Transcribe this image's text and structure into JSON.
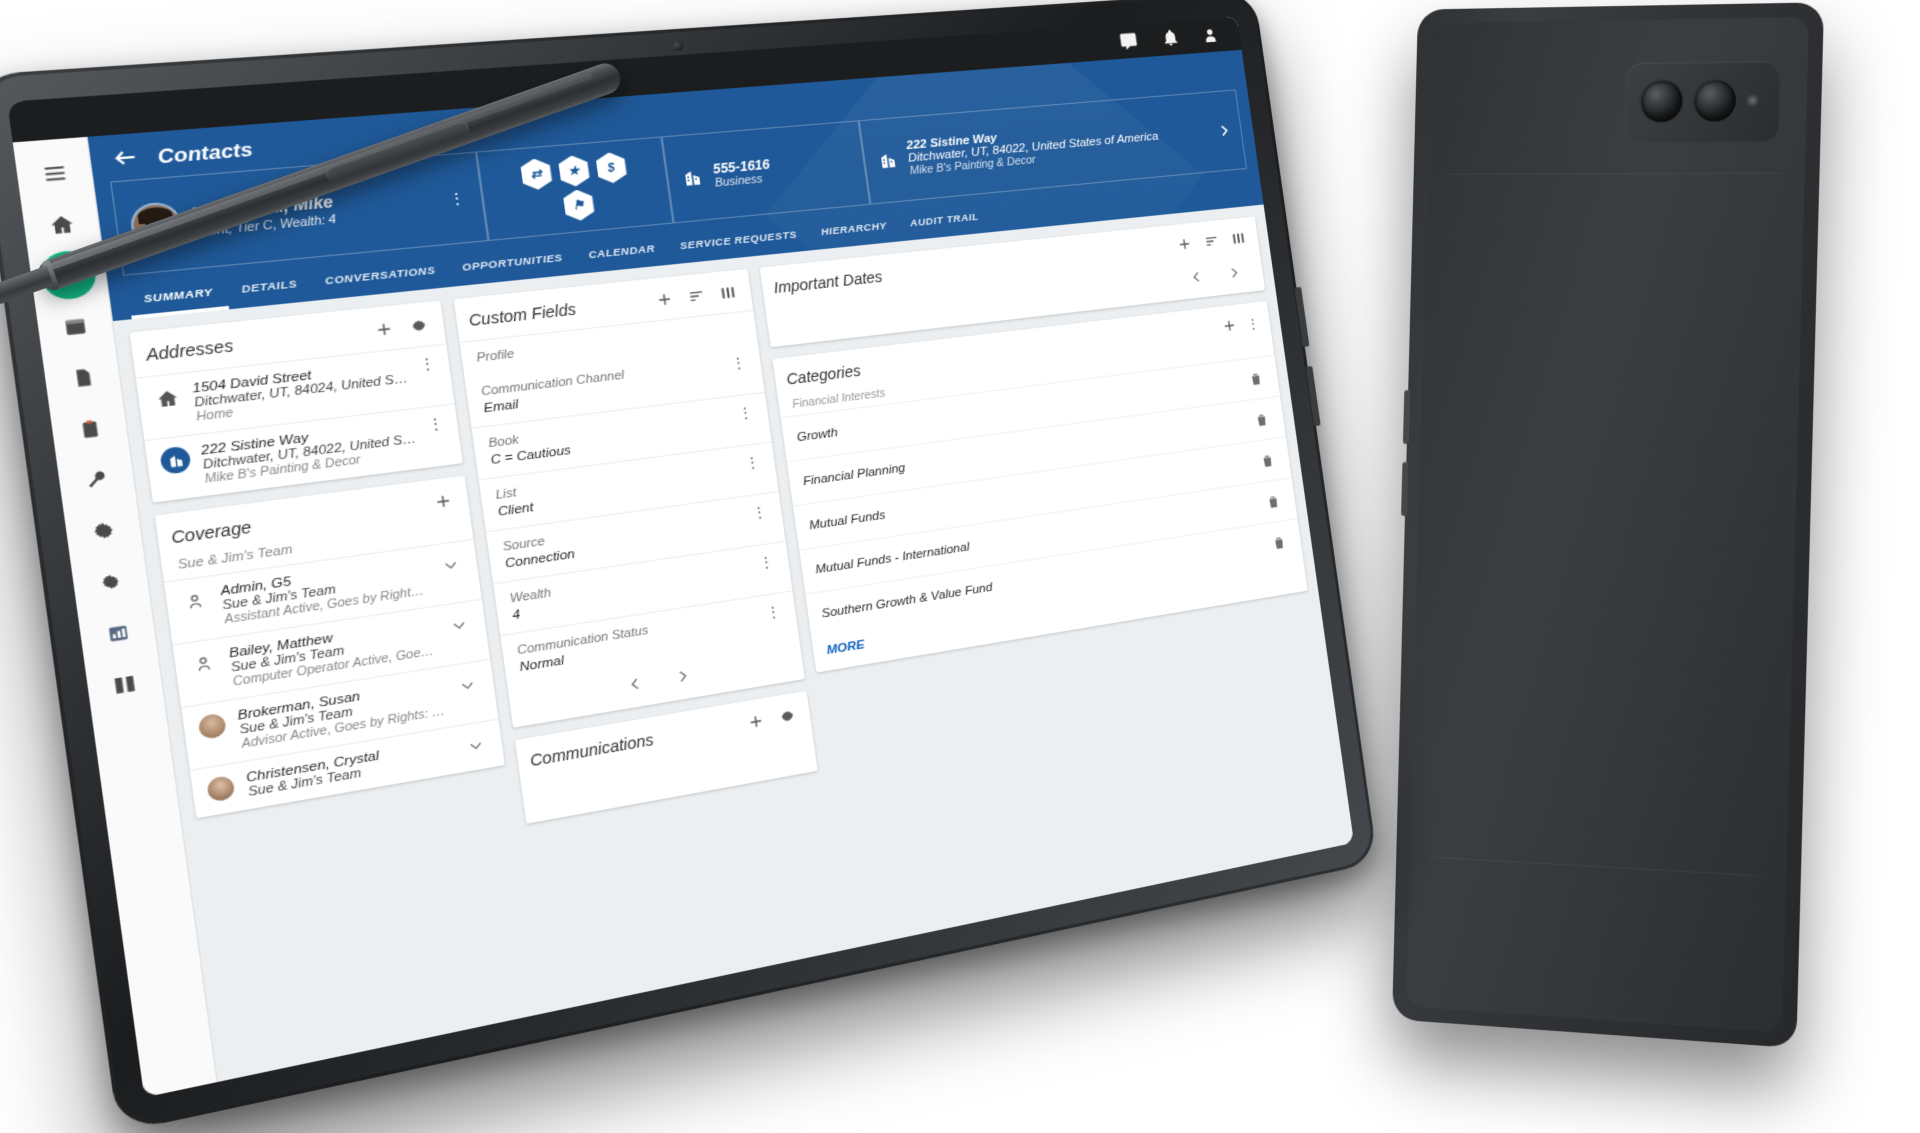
{
  "statusbar": {
    "icons": [
      "message-icon",
      "bell-icon",
      "user-icon"
    ]
  },
  "rail": {
    "items": [
      {
        "name": "menu",
        "icon": "hamburger-menu-icon",
        "active": false
      },
      {
        "name": "home",
        "icon": "home-icon",
        "active": false
      },
      {
        "name": "contacts",
        "icon": "person-circle-icon",
        "active": true
      },
      {
        "name": "calendar",
        "icon": "calendar-icon",
        "active": false
      },
      {
        "name": "notes",
        "icon": "document-icon",
        "active": false
      },
      {
        "name": "tasks",
        "icon": "clipboard-icon",
        "active": false
      },
      {
        "name": "tools",
        "icon": "wrench-icon",
        "active": false
      },
      {
        "name": "settings-gear",
        "icon": "gear-icon",
        "active": false
      },
      {
        "name": "preferences",
        "icon": "gear-small-icon",
        "active": false
      },
      {
        "name": "reports",
        "icon": "chart-icon",
        "active": false
      },
      {
        "name": "library",
        "icon": "book-icon",
        "active": false
      }
    ]
  },
  "topbar": {
    "back_icon": "back-arrow-icon",
    "title": "Contacts",
    "contact": {
      "name": "Buonarroti, Mike",
      "subtitle": "Client, Tier C, Wealth: 4",
      "kebab": "⋮"
    },
    "badges": [
      {
        "glyph": "⇄",
        "name": "exchange-badge"
      },
      {
        "glyph": "★",
        "name": "star-badge"
      },
      {
        "glyph": "$",
        "name": "dollar-badge"
      },
      {
        "glyph": "⚑",
        "name": "flag-badge"
      }
    ],
    "phone": {
      "number": "555-1616",
      "label": "Business",
      "icon": "building-icon"
    },
    "address": {
      "line1": "222 Sistine Way",
      "line2": "Ditchwater, UT, 84022, United States of America",
      "line3": "Mike B's Painting & Decor",
      "icon": "building-icon",
      "next_icon": "chevron-right-icon"
    }
  },
  "tabs": [
    {
      "label": "SUMMARY",
      "active": true
    },
    {
      "label": "DETAILS",
      "active": false
    },
    {
      "label": "CONVERSATIONS",
      "active": false
    },
    {
      "label": "OPPORTUNITIES",
      "active": false
    },
    {
      "label": "CALENDAR",
      "active": false
    },
    {
      "label": "SERVICE REQUESTS",
      "active": false
    },
    {
      "label": "HIERARCHY",
      "active": false
    },
    {
      "label": "AUDIT TRAIL",
      "active": false
    }
  ],
  "cards": {
    "addresses": {
      "title": "Addresses",
      "add_icon": "plus-icon",
      "settings_icon": "gear-icon",
      "rows": [
        {
          "icon": "home-icon",
          "main": "1504 David Street",
          "sub": "Ditchwater, UT, 84024, United States of A…",
          "sub2": "Home",
          "kebab": "⋮"
        },
        {
          "icon": "building-icon",
          "main": "222 Sistine Way",
          "sub": "Ditchwater, UT, 84022, United States of A…",
          "sub2": "Mike B's Painting & Decor",
          "kebab": "⋮"
        }
      ]
    },
    "coverage": {
      "title": "Coverage",
      "add_icon": "plus-icon",
      "team": "Sue & Jim's Team",
      "rows": [
        {
          "icon": "person-icon",
          "name": "Admin, G5",
          "team": "Sue & Jim's Team",
          "role": "Assistant Active, Goes by Rights: No",
          "chevron": "chevron-down-icon"
        },
        {
          "icon": "person-icon",
          "name": "Bailey, Matthew",
          "team": "Sue & Jim's Team",
          "role": "Computer Operator Active, Goes by Right…",
          "chevron": "chevron-down-icon"
        },
        {
          "icon": "avatar-icon",
          "name": "Brokerman, Susan",
          "team": "Sue & Jim's Team",
          "role": "Advisor Active, Goes by Rights: No",
          "chevron": "chevron-down-icon"
        },
        {
          "icon": "avatar-icon",
          "name": "Christensen, Crystal",
          "team": "Sue & Jim's Team",
          "role": "",
          "chevron": "chevron-down-icon"
        }
      ]
    },
    "custom_fields": {
      "title": "Custom Fields",
      "add_icon": "plus-icon",
      "sort_icon": "sort-icon",
      "columns_icon": "columns-icon",
      "fields": [
        {
          "label": "Profile",
          "value": "",
          "kebab": ""
        },
        {
          "label": "Communication Channel",
          "value": "Email",
          "kebab": "⋮"
        },
        {
          "label": "Book",
          "value": "C = Cautious",
          "kebab": "⋮"
        },
        {
          "label": "List",
          "value": "Client",
          "kebab": "⋮"
        },
        {
          "label": "Source",
          "value": "Connection",
          "kebab": "⋮"
        },
        {
          "label": "Wealth",
          "value": "4",
          "kebab": "⋮"
        },
        {
          "label": "Communication Status",
          "value": "Normal",
          "kebab": "⋮"
        }
      ],
      "prev_icon": "chevron-left-icon",
      "next_icon": "chevron-right-icon"
    },
    "communications": {
      "title": "Communications",
      "add_icon": "plus-icon",
      "settings_icon": "gear-icon"
    },
    "important_dates": {
      "title": "Important Dates",
      "add_icon": "plus-icon",
      "sort_icon": "sort-icon",
      "columns_icon": "columns-icon",
      "prev_icon": "chevron-left-icon",
      "next_icon": "chevron-right-icon"
    },
    "categories": {
      "title": "Categories",
      "add_icon": "plus-icon",
      "kebab_icon": "⋮",
      "section_label": "Financial Interests",
      "items": [
        {
          "label": "Growth",
          "delete_icon": "trash-icon"
        },
        {
          "label": "Financial Planning",
          "delete_icon": "trash-icon"
        },
        {
          "label": "Mutual Funds",
          "delete_icon": "trash-icon"
        },
        {
          "label": "Mutual Funds - International",
          "delete_icon": "trash-icon"
        },
        {
          "label": "Southern Growth & Value Fund",
          "delete_icon": "trash-icon"
        }
      ],
      "more_label": "MORE"
    }
  },
  "colors": {
    "brand_blue": "#1f5999",
    "accent_green": "#12b886",
    "link_blue": "#1565c0"
  }
}
